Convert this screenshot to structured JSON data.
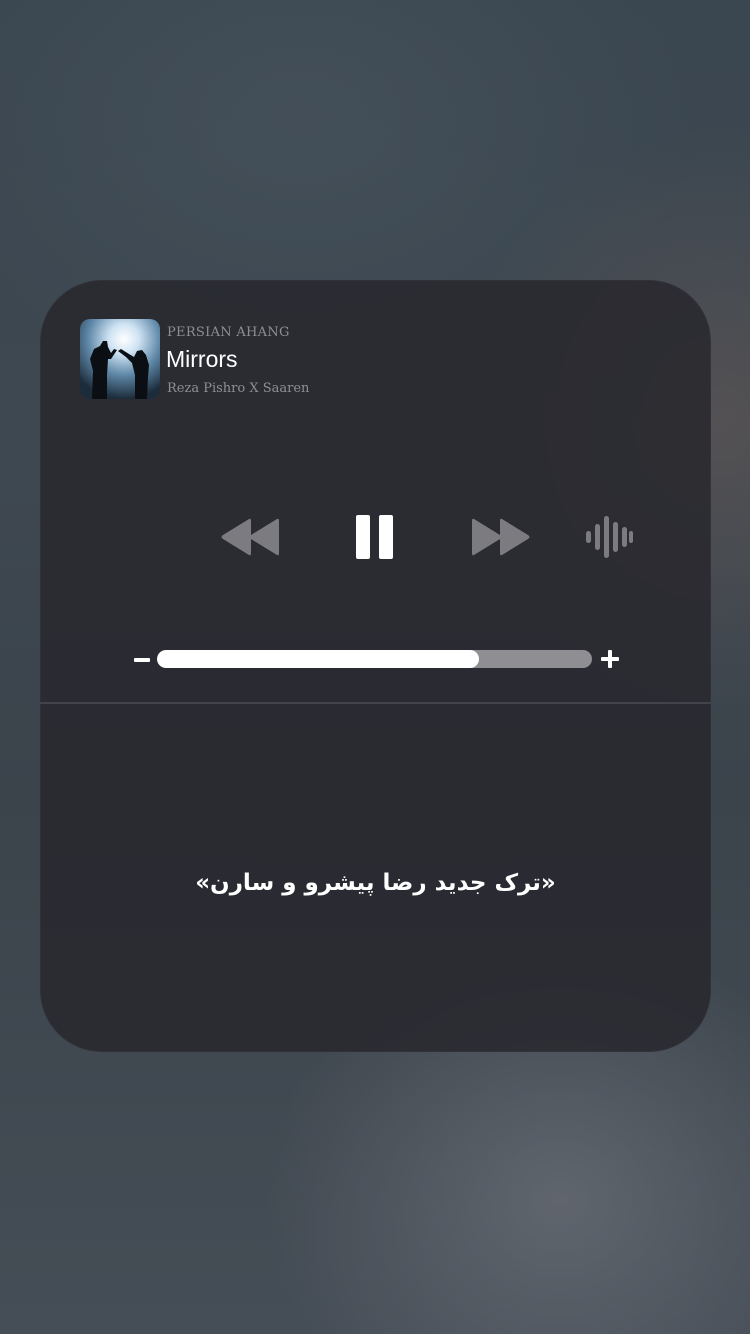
{
  "now_playing": {
    "source": "PERSIAN AHANG",
    "title": "Mirrors",
    "artist": "Reza Pishro X Saaren"
  },
  "controls": {
    "rewind_icon": "rewind-icon",
    "pause_icon": "pause-icon",
    "forward_icon": "fast-forward-icon",
    "audio_output_icon": "waveform-icon",
    "minus_icon": "minus-icon",
    "plus_icon": "plus-icon"
  },
  "volume": {
    "level_percent": 74
  },
  "caption": "«ترک جدید رضا پیشرو و سارن»",
  "colors": {
    "card_background": "#2a2a2e",
    "primary_text": "#ffffff",
    "secondary_text": "#8e8e93",
    "inactive_control": "#7c7c80"
  }
}
